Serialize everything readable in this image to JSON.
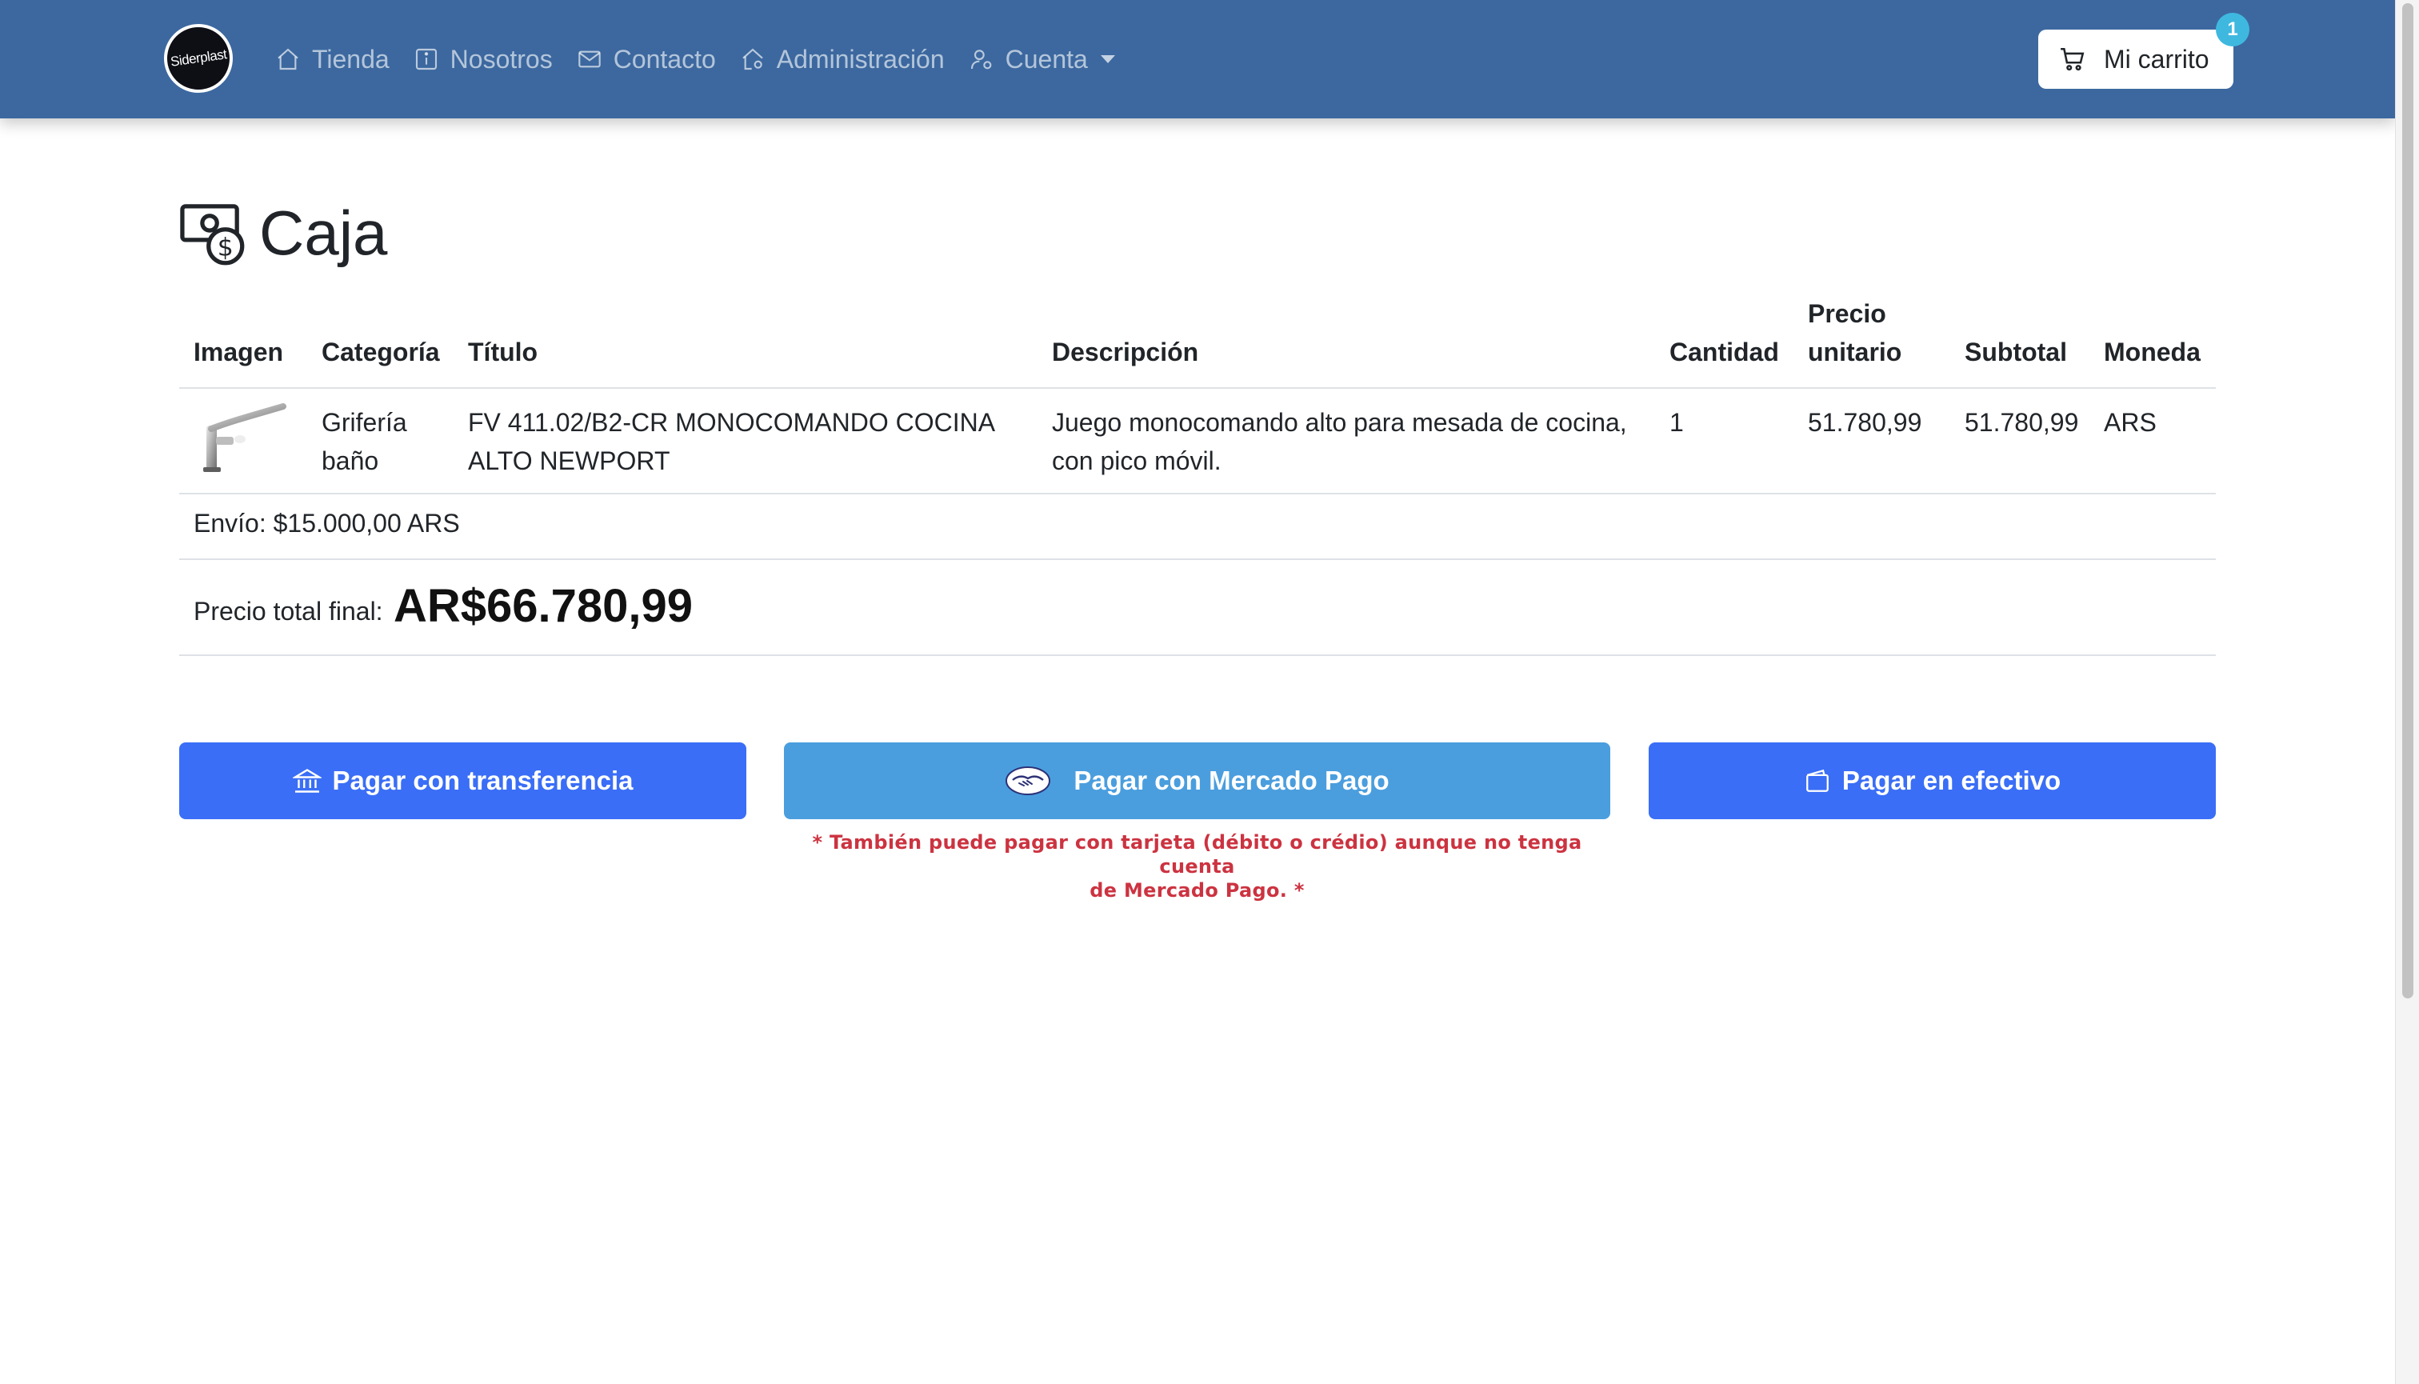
{
  "navbar": {
    "logo_text": "Siderplast",
    "links": [
      {
        "label": "Tienda",
        "icon": "home-icon"
      },
      {
        "label": "Nosotros",
        "icon": "info-icon"
      },
      {
        "label": "Contacto",
        "icon": "envelope-icon"
      },
      {
        "label": "Administración",
        "icon": "house-gear-icon"
      },
      {
        "label": "Cuenta",
        "icon": "user-gear-icon"
      }
    ],
    "cart_label": "Mi carrito",
    "cart_count": "1"
  },
  "page": {
    "title": "Caja"
  },
  "table": {
    "headers": {
      "imagen": "Imagen",
      "categoria": "Categoría",
      "titulo": "Título",
      "descripcion": "Descripción",
      "cantidad": "Cantidad",
      "precio_l1": "Precio",
      "precio_l2": "unitario",
      "subtotal": "Subtotal",
      "moneda": "Moneda"
    },
    "rows": [
      {
        "categoria_l1": "Grifería",
        "categoria_l2": "baño",
        "titulo_l1": "FV 411.02/B2-CR MONOCOMANDO COCINA",
        "titulo_l2": "ALTO NEWPORT",
        "descripcion_l1": "Juego monocomando alto para mesada de cocina,",
        "descripcion_l2": "con pico móvil.",
        "cantidad": "1",
        "precio_unitario": "51.780,99",
        "subtotal": "51.780,99",
        "moneda": "ARS"
      }
    ],
    "shipping": "Envío: $15.000,00 ARS",
    "total_label": "Precio total final:",
    "total_value": "AR$66.780,99"
  },
  "actions": {
    "transfer_label": "Pagar con transferencia",
    "mercadopago_label": "Pagar con Mercado Pago",
    "cash_label": "Pagar en efectivo",
    "mercadopago_note_l1": "* También puede pagar con tarjeta (débito o crédio) aunque no tenga cuenta",
    "mercadopago_note_l2": "de Mercado Pago. *"
  },
  "colors": {
    "navbar": "#3c689f",
    "primary_button": "#3a6ef6",
    "mercadopago_button": "#4a9ede",
    "note_text": "#cc3340",
    "badge": "#3fb8e0"
  }
}
